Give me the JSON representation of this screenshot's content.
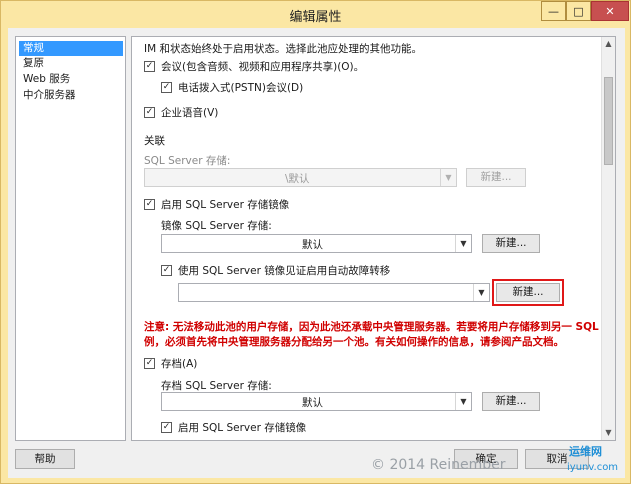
{
  "window": {
    "title": "编辑属性",
    "close_glyph": "✕",
    "min_glyph": "—",
    "max_glyph": "□"
  },
  "nav": {
    "items": [
      {
        "label": "常规",
        "selected": true
      },
      {
        "label": "复原",
        "selected": false
      },
      {
        "label": "Web 服务",
        "selected": false
      },
      {
        "label": "中介服务器",
        "selected": false
      }
    ]
  },
  "panel": {
    "intro": "IM 和状态始终处于启用状态。选择此池应处理的其他功能。",
    "conferencing_label": "会议(包含音频、视频和应用程序共享)(O)。",
    "dialin_label": "电话拨入式(PSTN)会议(D)",
    "enterprise_voice_label": "企业语音(V)",
    "assoc_heading": "关联",
    "sqlstore_label": "SQL Server 存储:",
    "sqlstore_value": "\\默认",
    "sqlstore_new": "新建...",
    "mirror_enable_label": "启用 SQL Server 存储镜像",
    "mirror_store_label": "镜像 SQL Server 存储:",
    "mirror_store_value": "默认",
    "mirror_new": "新建...",
    "witness_label": "使用 SQL Server 镜像见证启用自动故障转移",
    "witness_value": "",
    "witness_new": "新建...",
    "warning_line1": "注意: 无法移动此池的用户存储，因为此池还承载中央管理服务器。若要将用户存储移到另一 SQL 实",
    "warning_line2": "例，必须首先将中央管理服务器分配给另一个池。有关如何操作的信息，请参阅产品文档。",
    "archive_label": "存档(A)",
    "archive_store_label": "存档 SQL Server 存储:",
    "archive_store_value": "默认",
    "archive_new": "新建...",
    "archive_mirror_label": "启用 SQL Server 存储镜像"
  },
  "buttons": {
    "help": "帮助",
    "ok": "确定",
    "cancel": "取消"
  },
  "watermark": {
    "text": "© 2014 Reinember",
    "logo_name": "运维网",
    "logo_url": "iyunv.com"
  },
  "colors": {
    "selection": "#3399ff",
    "warning": "#d00000",
    "highlight": "#e01818",
    "titlebar": "#fbe7a4"
  }
}
